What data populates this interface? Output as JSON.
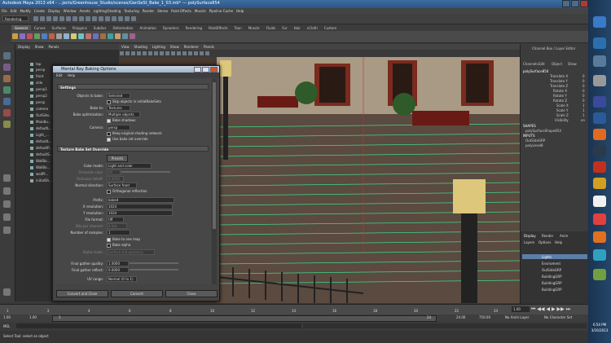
{
  "window": {
    "title_prefix": "Autodesk Maya 2013 x64",
    "title_path": "...jects/Greenhouse_Studio/scenes/GenSeSt_Bake_1_03.mb*",
    "title_selection": "polySurface854"
  },
  "menu": [
    "File",
    "Edit",
    "Modify",
    "Create",
    "Display",
    "Window",
    "Assets",
    "Lighting/Shading",
    "Texturing",
    "Render",
    "Stereo",
    "Paint Effects",
    "Muscle",
    "Pipeline Cache",
    "Help"
  ],
  "toolbar": {
    "mode_select": "Rendering"
  },
  "shelf_tabs": [
    "General",
    "Curves",
    "Surfaces",
    "Polygons",
    "Subdivs",
    "Deformation",
    "Animation",
    "Dynamics",
    "Rendering",
    "PaintEffects",
    "Toon",
    "Muscle",
    "Fluids",
    "Fur",
    "Hair",
    "nCloth",
    "Custom"
  ],
  "outliner": {
    "menu": [
      "Display",
      "Show",
      "Panels"
    ],
    "items": [
      "top",
      "persp",
      "front",
      "side",
      "persp1",
      "persp2",
      "persp",
      "camera",
      "OutSide...",
      "MainBu...",
      "defaultL...",
      "Light_...",
      "defaultL...",
      "defaultP...",
      "defaultS...",
      "WallBo...",
      "WallBo...",
      "wallPl...",
      "initialSh..."
    ]
  },
  "viewport": {
    "menu": [
      "View",
      "Shading",
      "Lighting",
      "Show",
      "Renderer",
      "Panels"
    ]
  },
  "dialog": {
    "title": "Mental Ray Baking Options",
    "help": "Help",
    "edit": "Edit",
    "settings_header": "Settings",
    "objects_to_bake_label": "Objects to bake:",
    "objects_to_bake": "Selected",
    "skip_objects": "Skip objects in initialBakeSets",
    "bake_to_label": "Bake to:",
    "bake_to": "Textures",
    "bake_opt_label": "Bake optimization:",
    "bake_opt": "Multiple objects",
    "bake_shadows": "Bake shadows",
    "camera_label": "Camera:",
    "camera": "persp",
    "keep_shading": "Keep original shading network",
    "use_bake_set": "Use bake set override",
    "override_header": "Texture Bake Set Override",
    "presets": "Presets",
    "color_mode_label": "Color mode:",
    "color_mode": "Light and color",
    "occlusion_rays_label": "Occlusion rays:",
    "occlusion_rays": "64",
    "occlusion_falloff_label": "Occlusion falloff:",
    "occlusion_falloff": "0.0000",
    "normal_dir_label": "Normal direction:",
    "normal_dir": "Surface front",
    "ortho": "Orthogonal reflection",
    "prefix_label": "Prefix:",
    "prefix": "baked",
    "xres_label": "X resolution:",
    "xres": "1024",
    "yres_label": "Y resolution:",
    "yres": "1024",
    "file_format_label": "File format:",
    "file_format": "tiff",
    "bits_label": "Bits per channel:",
    "bits": "8 bits",
    "samples_label": "Number of samples:",
    "samples": "1",
    "bake_one_map": "Bake to one map",
    "bake_alpha": "Bake alpha",
    "alpha_mode_label": "Alpha mode:",
    "alpha_mode": "Surface transparency",
    "fg_quality_label": "Final gather quality:",
    "fg_quality": "1.0000",
    "fg_reflect_label": "Final gather reflect:",
    "fg_reflect": "0.0000",
    "uv_range_label": "UV range:",
    "uv_range": "Normal (0 to 1)",
    "btn_convert_close": "Convert and Close",
    "btn_convert": "Convert",
    "btn_close": "Close"
  },
  "channel_box": {
    "title": "Channel Box / Layer Editor",
    "menu": [
      "Channels",
      "Edit",
      "Object",
      "Show"
    ],
    "object": "polySurface854",
    "attrs": [
      {
        "name": "Translate X",
        "value": "0"
      },
      {
        "name": "Translate Y",
        "value": "0"
      },
      {
        "name": "Translate Z",
        "value": "0"
      },
      {
        "name": "Rotate X",
        "value": "0"
      },
      {
        "name": "Rotate Y",
        "value": "0"
      },
      {
        "name": "Rotate Z",
        "value": "0"
      },
      {
        "name": "Scale X",
        "value": "1"
      },
      {
        "name": "Scale Y",
        "value": "1"
      },
      {
        "name": "Scale Z",
        "value": "1"
      },
      {
        "name": "Visibility",
        "value": "on"
      }
    ],
    "shapes_label": "SHAPES",
    "shape": "polySurfaceShape854",
    "inputs_label": "INPUTS",
    "inputs": [
      "OutSideGRP",
      "polyLevel8"
    ]
  },
  "layers": {
    "tabs": [
      "Display",
      "Render",
      "Anim"
    ],
    "menu": [
      "Layers",
      "Options",
      "Help"
    ],
    "items": [
      "Lights",
      "Enviroment",
      "OutSideGRP",
      "BuildingGRP",
      "BuildingGRP",
      "BuildingGRP"
    ]
  },
  "timeline": {
    "ticks": [
      "1",
      "2",
      "4",
      "6",
      "8",
      "10",
      "12",
      "14",
      "16",
      "18",
      "20",
      "22",
      "24"
    ],
    "current": "1.00",
    "start": "1.00",
    "range_start": "1",
    "range_end": "24",
    "end": "24.00",
    "end2": "750.00",
    "anim_layer": "No Anim Layer",
    "char_set": "No Character Set"
  },
  "mel_label": "MEL",
  "help_text": "Select Tool: select an object",
  "clock": {
    "time": "6:54 PM",
    "date": "3/16/2013"
  },
  "colors": {
    "accent": "#3d6ea0",
    "grid_green": "#3fd88a",
    "selection": "#5c7fa8"
  }
}
